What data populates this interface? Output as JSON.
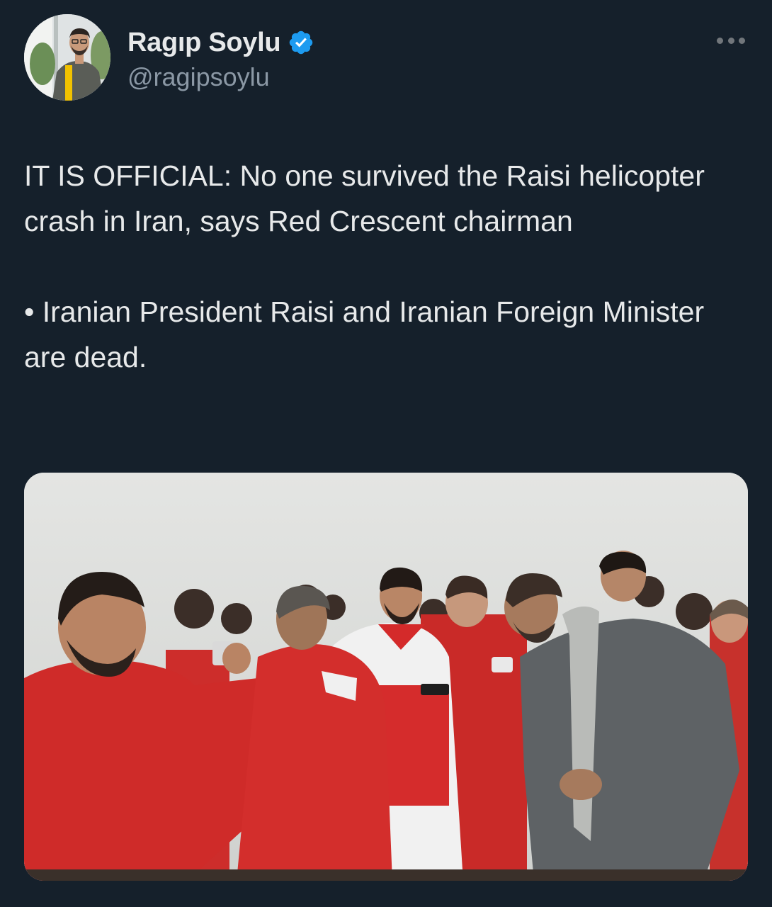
{
  "author": {
    "display_name": "Ragıp Soylu",
    "handle": "@ragipsoylu",
    "verified": true
  },
  "tweet": {
    "paragraphs": [
      "IT IS OFFICIAL: No one survived the Raisi helicopter crash in Iran, says Red Crescent chairman",
      "• Iranian President Raisi and Iranian Foreign Minister are dead."
    ]
  },
  "icons": {
    "verified": "verified-badge-icon",
    "more": "more-options-icon"
  },
  "colors": {
    "background": "#15202b",
    "text": "#e7e9ea",
    "secondary_text": "#8b98a5",
    "verified_blue": "#1d9bf0",
    "jacket_red": "#d42a2a"
  }
}
